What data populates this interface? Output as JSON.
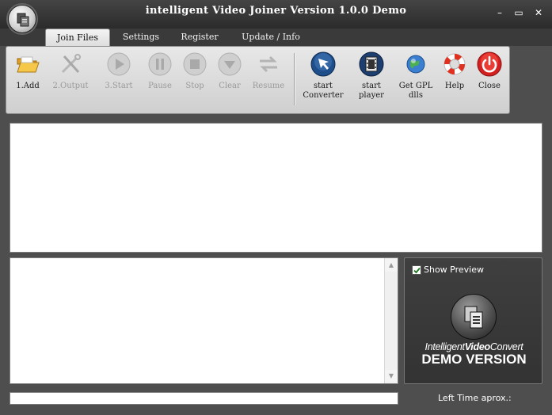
{
  "window": {
    "title": "intelligent Video Joiner Version 1.0.0 Demo",
    "minimize_glyph": "–",
    "maximize_glyph": "▭",
    "close_glyph": "✕"
  },
  "tabs": [
    {
      "label": "Join Files",
      "active": true
    },
    {
      "label": "Settings",
      "active": false
    },
    {
      "label": "Register",
      "active": false
    },
    {
      "label": "Update / Info",
      "active": false
    }
  ],
  "toolbar": {
    "items": [
      {
        "label": "1.Add",
        "icon": "folder-open-icon",
        "enabled": true
      },
      {
        "label": "2.Output",
        "icon": "tools-icon",
        "enabled": false
      },
      {
        "label": "3.Start",
        "icon": "play-icon",
        "enabled": false
      },
      {
        "label": "Pause",
        "icon": "pause-icon",
        "enabled": false
      },
      {
        "label": "Stop",
        "icon": "stop-icon",
        "enabled": false
      },
      {
        "label": "Clear",
        "icon": "clear-icon",
        "enabled": false
      },
      {
        "label": "Resume",
        "icon": "resume-icon",
        "enabled": false
      },
      {
        "label": "start\nConverter",
        "icon": "arrow-cursor-icon",
        "enabled": true
      },
      {
        "label": "start\nplayer",
        "icon": "film-icon",
        "enabled": true
      },
      {
        "label": "Get GPL\ndlls",
        "icon": "globe-icon",
        "enabled": true
      },
      {
        "label": "Help",
        "icon": "lifebuoy-icon",
        "enabled": true
      },
      {
        "label": "Close",
        "icon": "power-icon",
        "enabled": true
      }
    ]
  },
  "preview": {
    "show_preview_label": "Show Preview",
    "show_preview_checked": true,
    "brand_prefix": "Intelligent",
    "brand_middle": "Video",
    "brand_suffix": "Convert",
    "demo_label": "DEMO VERSION"
  },
  "status": {
    "progress": 0,
    "left_time_label": "Left Time aprox.:"
  },
  "colors": {
    "background": "#4e4e4e",
    "toolbar_bg": "#dcdcdc",
    "disabled_text": "#9a9a9a",
    "help_red": "#e03020",
    "close_red": "#d42020",
    "converter_blue": "#1f4f8a"
  }
}
